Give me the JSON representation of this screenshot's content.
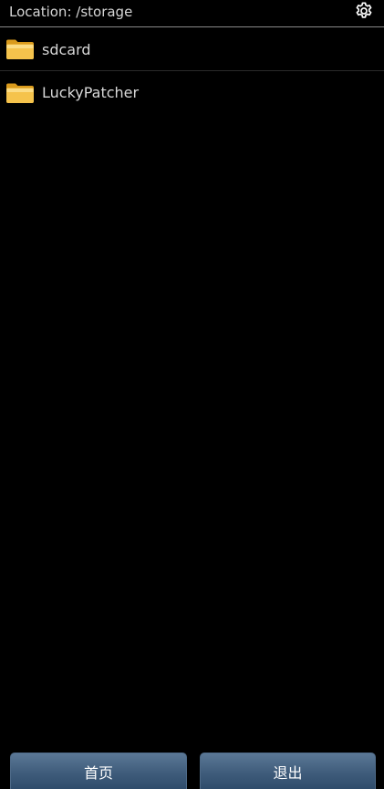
{
  "header": {
    "location_text": "Location: /storage",
    "settings_icon": "gear-icon"
  },
  "folders": [
    {
      "label": "sdcard",
      "icon": "folder-icon"
    },
    {
      "label": "LuckyPatcher",
      "icon": "folder-icon"
    }
  ],
  "buttons": {
    "home_label": "首页",
    "exit_label": "退出"
  },
  "colors": {
    "background": "#000000",
    "text": "#d8d8d8",
    "folder_yellow": "#f2c04a",
    "button_blue": "#3f5c7b"
  }
}
